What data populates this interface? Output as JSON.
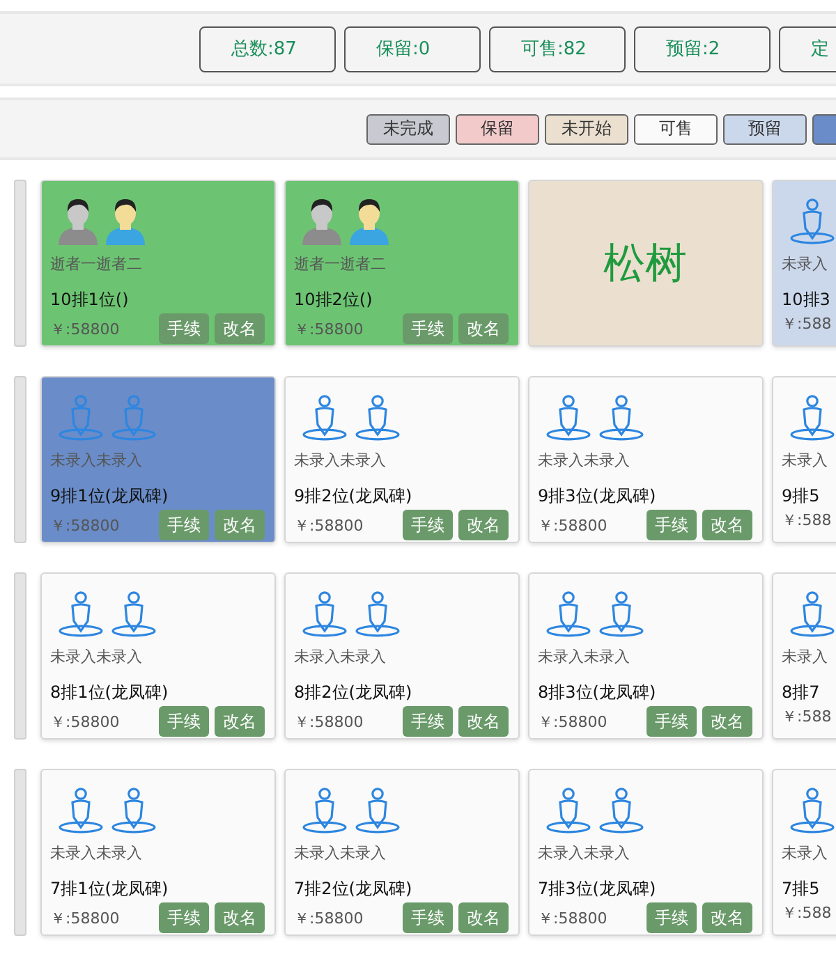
{
  "stats": [
    {
      "label": "总数:87"
    },
    {
      "label": "保留:0"
    },
    {
      "label": "可售:82"
    },
    {
      "label": "预留:2"
    },
    {
      "label": "定"
    }
  ],
  "legend": [
    {
      "label": "未完成",
      "color": "#c8c9d1"
    },
    {
      "label": "保留",
      "color": "#f3caca"
    },
    {
      "label": "未开始",
      "color": "#ebe0cf"
    },
    {
      "label": "可售",
      "color": "#fafafa"
    },
    {
      "label": "预留",
      "color": "#cbd8ec"
    },
    {
      "color": "#6a8cc8"
    }
  ],
  "rows": [
    {
      "cards": [
        {
          "kind": "person",
          "color": "#6cc472",
          "names": "逝者一逝者二",
          "position": "10排1位()",
          "price": "￥:58800",
          "buttons": [
            "手续",
            "改名"
          ]
        },
        {
          "kind": "person",
          "color": "#6cc472",
          "names": "逝者一逝者二",
          "position": "10排2位()",
          "price": "￥:58800",
          "buttons": [
            "手续",
            "改名"
          ]
        },
        {
          "kind": "tree",
          "color": "#ebe0cf",
          "label": "松树"
        },
        {
          "kind": "empty",
          "color": "#cbd8ec",
          "names": "未录入",
          "position": "10排3",
          "price": "￥:588"
        }
      ]
    },
    {
      "cards": [
        {
          "kind": "empty",
          "color": "#6a8cc8",
          "names": "未录入未录入",
          "position": "9排1位(龙凤碑)",
          "price": "￥:58800",
          "buttons": [
            "手续",
            "改名"
          ]
        },
        {
          "kind": "empty",
          "color": "#fafafa",
          "names": "未录入未录入",
          "position": "9排2位(龙凤碑)",
          "price": "￥:58800",
          "buttons": [
            "手续",
            "改名"
          ]
        },
        {
          "kind": "empty",
          "color": "#fafafa",
          "names": "未录入未录入",
          "position": "9排3位(龙凤碑)",
          "price": "￥:58800",
          "buttons": [
            "手续",
            "改名"
          ]
        },
        {
          "kind": "empty",
          "color": "#fafafa",
          "names": "未录入",
          "position": "9排5",
          "price": "￥:588"
        }
      ]
    },
    {
      "cards": [
        {
          "kind": "empty",
          "color": "#fafafa",
          "names": "未录入未录入",
          "position": "8排1位(龙凤碑)",
          "price": "￥:58800",
          "buttons": [
            "手续",
            "改名"
          ]
        },
        {
          "kind": "empty",
          "color": "#fafafa",
          "names": "未录入未录入",
          "position": "8排2位(龙凤碑)",
          "price": "￥:58800",
          "buttons": [
            "手续",
            "改名"
          ]
        },
        {
          "kind": "empty",
          "color": "#fafafa",
          "names": "未录入未录入",
          "position": "8排3位(龙凤碑)",
          "price": "￥:58800",
          "buttons": [
            "手续",
            "改名"
          ]
        },
        {
          "kind": "empty",
          "color": "#fafafa",
          "names": "未录入",
          "position": "8排7",
          "price": "￥:588"
        }
      ]
    },
    {
      "cards": [
        {
          "kind": "empty",
          "color": "#fafafa",
          "names": "未录入未录入",
          "position": "7排1位(龙凤碑)",
          "price": "￥:58800",
          "buttons": [
            "手续",
            "改名"
          ]
        },
        {
          "kind": "empty",
          "color": "#fafafa",
          "names": "未录入未录入",
          "position": "7排2位(龙凤碑)",
          "price": "￥:58800",
          "buttons": [
            "手续",
            "改名"
          ]
        },
        {
          "kind": "empty",
          "color": "#fafafa",
          "names": "未录入未录入",
          "position": "7排3位(龙凤碑)",
          "price": "￥:58800",
          "buttons": [
            "手续",
            "改名"
          ]
        },
        {
          "kind": "empty",
          "color": "#fafafa",
          "names": "未录入",
          "position": "7排5",
          "price": "￥:588"
        }
      ]
    }
  ]
}
